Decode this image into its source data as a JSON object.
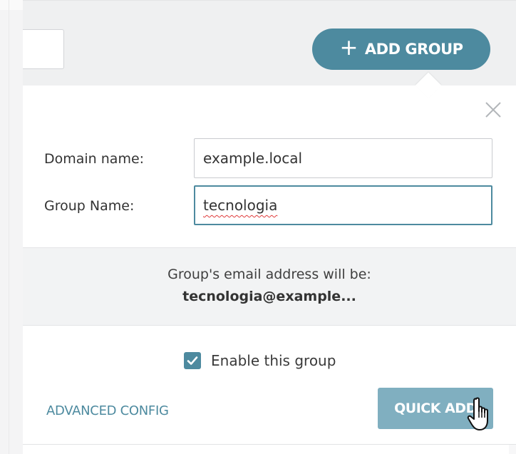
{
  "toolbar": {
    "search_value": "",
    "add_group_label": "ADD GROUP",
    "add_group_icon": "plus-icon"
  },
  "form": {
    "domain_label": "Domain name:",
    "domain_value": "example.local",
    "group_label": "Group Name:",
    "group_value": "tecnologia",
    "close_icon": "close-icon"
  },
  "email_preview": {
    "intro": "Group's email address will be:",
    "address": "tecnologia@example..."
  },
  "enable": {
    "label": "Enable this group",
    "checked": true
  },
  "actions": {
    "advanced_label": "ADVANCED CONFIG",
    "quick_add_label": "QUICK ADD"
  },
  "colors": {
    "accent": "#4d8a9f",
    "accent_light": "#80afc0",
    "panel_bg": "#f2f3f4"
  }
}
